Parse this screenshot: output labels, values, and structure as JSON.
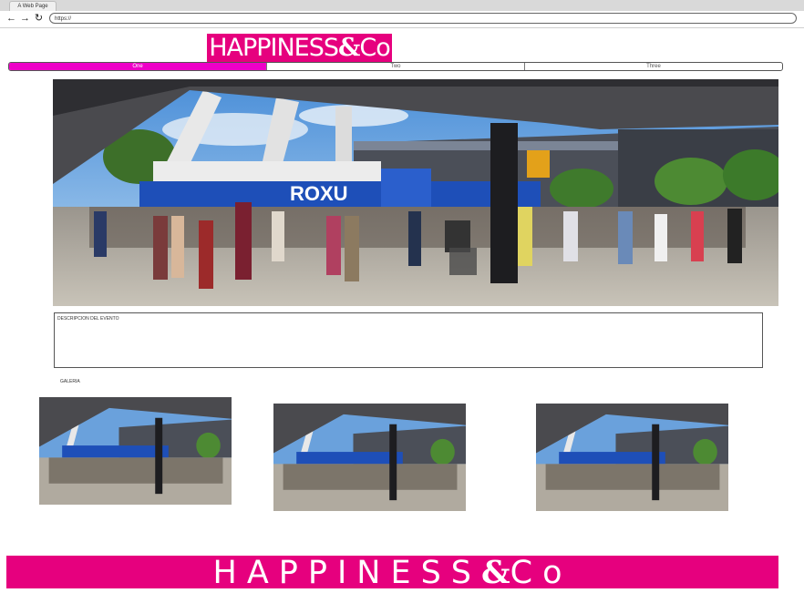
{
  "browser": {
    "tab_title": "A Web Page",
    "back_icon": "←",
    "forward_icon": "→",
    "reload_icon": "↻",
    "url": "https://"
  },
  "brand": {
    "name_part1": "HAPPINESS",
    "amp": "&",
    "name_part2": "Co",
    "color": "#e6007e"
  },
  "nav": {
    "tabs": [
      "One",
      "Two",
      "Three"
    ],
    "active_color": "#ee00c8"
  },
  "main": {
    "description_label": "DESCRIPCION DEL EVENTO",
    "gallery_label": "GALERIA",
    "photo_labels": {
      "crane_text": "ROXU"
    }
  }
}
